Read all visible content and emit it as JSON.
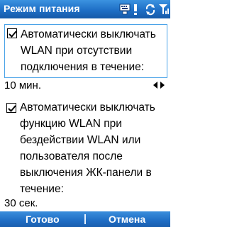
{
  "window": {
    "title": "Режим питания",
    "status_icons": [
      "keyboard-icon",
      "alert-icon",
      "sync-icon",
      "signal-icon"
    ]
  },
  "options": [
    {
      "checked": true,
      "label": "Автоматически выключать WLAN при отсутствии подключения в течение:",
      "value": "10 мин."
    },
    {
      "checked": true,
      "label": "Автоматически выключать функцию WLAN при бездействии WLAN или пользователя после выключения ЖК-панели в течение:",
      "value": "30 сек."
    }
  ],
  "softkeys": {
    "left": "Готово",
    "right": "Отмена"
  },
  "colors": {
    "bar": "#1f6fc6",
    "focus_border": "#4aa3e8"
  }
}
